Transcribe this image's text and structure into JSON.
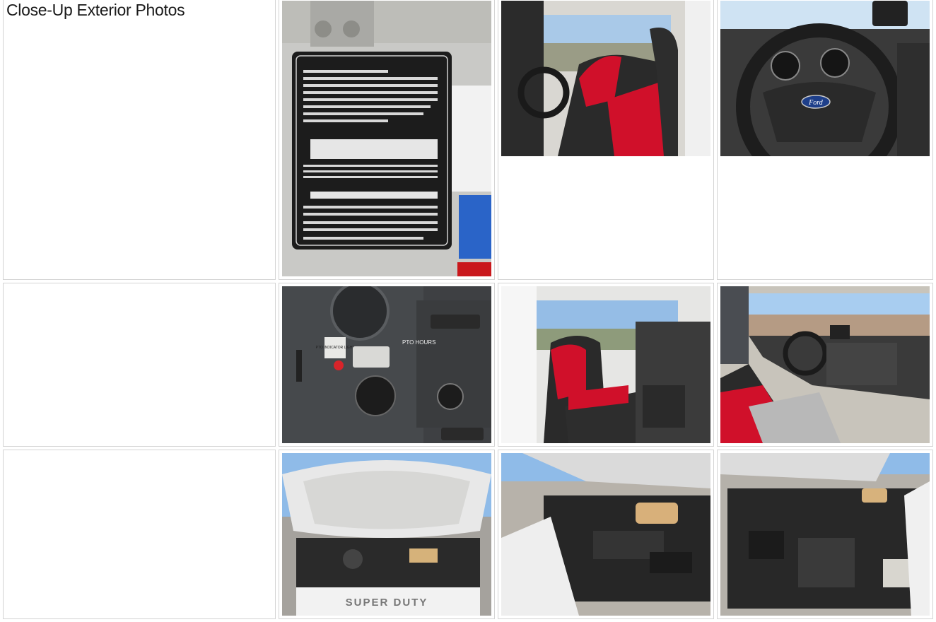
{
  "section": {
    "title": "Close-Up Exterior Photos"
  },
  "photos": [
    {
      "row": 1,
      "subject": "Altec equipment data plate",
      "plate_brand": "Altec"
    },
    {
      "row": 1,
      "subject": "Driver side interior with red and black seats"
    },
    {
      "row": 1,
      "subject": "Steering wheel and instrument cluster",
      "badge": "Ford"
    },
    {
      "row": 2,
      "subject": "Dashboard PTO controls",
      "labels": [
        "PTO INDICATOR LIGHT",
        "PTO HOURS"
      ]
    },
    {
      "row": 2,
      "subject": "Passenger side seats"
    },
    {
      "row": 2,
      "subject": "Cab interior dashboard view"
    },
    {
      "row": 3,
      "subject": "Engine bay with hood open",
      "grille_text": "SUPER DUTY"
    },
    {
      "row": 3,
      "subject": "Engine compartment left angle"
    },
    {
      "row": 3,
      "subject": "Engine compartment right angle"
    }
  ],
  "colors": {
    "seat_red": "#d0102a",
    "seat_black": "#2a2a2a",
    "sky": "#8fbbe8",
    "plate": "#1c1c1c"
  }
}
